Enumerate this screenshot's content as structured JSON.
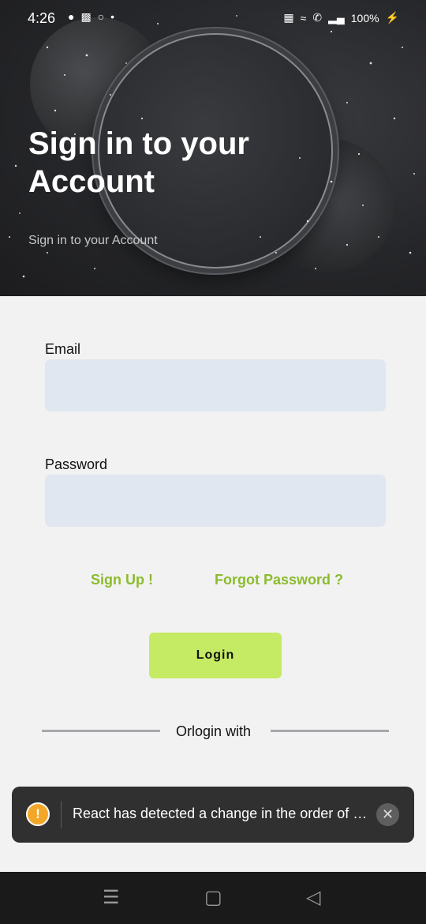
{
  "status_bar": {
    "time": "4:26",
    "left_icons": [
      "snapchat-icon",
      "lock-icon",
      "vpn-icon",
      "dot-icon"
    ],
    "battery": "100%",
    "right_icons": [
      "vibrate-icon",
      "wifi-icon",
      "call-icon",
      "signal-icon",
      "charging-icon"
    ]
  },
  "header": {
    "title": "Sign in to your Account",
    "subtitle": "Sign in to your Account"
  },
  "form": {
    "email_label": "Email",
    "email_value": "",
    "password_label": "Password",
    "password_value": "",
    "signup_link": "Sign Up !",
    "forgot_link": "Forgot Password ?",
    "login_button": "Login",
    "divider_text": "Orlogin with"
  },
  "toast": {
    "message": "React has detected a change in the order of Hooks called by Login.",
    "icon": "warning-icon"
  },
  "colors": {
    "accent": "#c5ea63",
    "link": "#8bbc2d",
    "input_bg": "#e1e7f0",
    "toast_bg": "#303030"
  }
}
